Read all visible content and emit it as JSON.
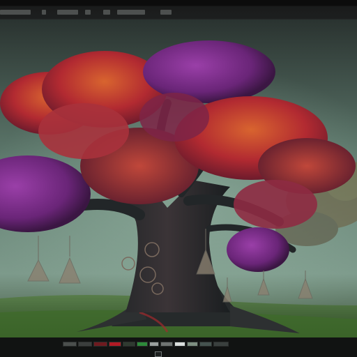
{
  "window": {
    "top_toolbar_items": 7,
    "palette_swatches": [
      {
        "name": "dark-gray",
        "color": "#4b4f4d"
      },
      {
        "name": "charcoal",
        "color": "#3b3e3d"
      },
      {
        "name": "dim-red",
        "color": "#6e1a1f"
      },
      {
        "name": "red",
        "color": "#b11a24"
      },
      {
        "name": "dark-olive",
        "color": "#2f3a30"
      },
      {
        "name": "green",
        "color": "#2d8a3a"
      },
      {
        "name": "light-gray",
        "color": "#9aa09e"
      },
      {
        "name": "gray",
        "color": "#6f7472"
      },
      {
        "name": "white",
        "color": "#d9dedc"
      },
      {
        "name": "sage",
        "color": "#7d8f80"
      },
      {
        "name": "teal-gray",
        "color": "#45534f"
      },
      {
        "name": "slate",
        "color": "#3a403e"
      }
    ]
  },
  "artwork": {
    "subject": "tree",
    "canopy_colors": [
      "#7a2f8e",
      "#b3272f",
      "#d3562a",
      "#5e2268"
    ],
    "sky_color": "#6f8a7c",
    "ground_color": "#3f6a2b"
  }
}
